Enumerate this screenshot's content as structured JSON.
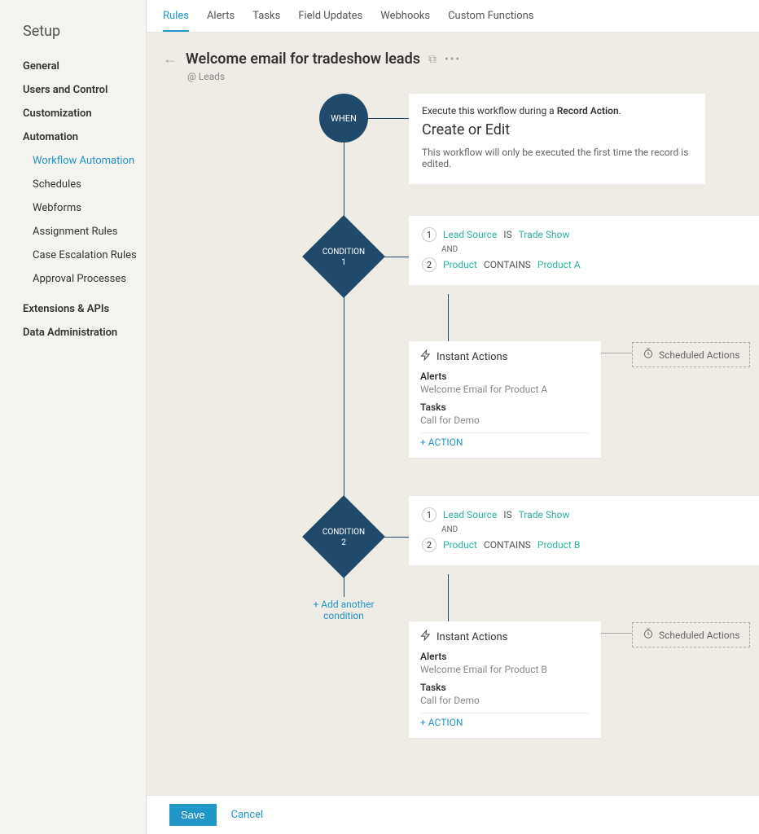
{
  "sidebar": {
    "title": "Setup",
    "groups": [
      {
        "label": "General"
      },
      {
        "label": "Users and Control"
      },
      {
        "label": "Customization"
      },
      {
        "label": "Automation",
        "subs": [
          "Workflow Automation",
          "Schedules",
          "Webforms",
          "Assignment Rules",
          "Case Escalation Rules",
          "Approval Processes"
        ]
      },
      {
        "label": "Extensions & APIs"
      },
      {
        "label": "Data Administration"
      }
    ]
  },
  "tabs": [
    "Rules",
    "Alerts",
    "Tasks",
    "Field Updates",
    "Webhooks",
    "Custom Functions"
  ],
  "header": {
    "title": "Welcome email for tradeshow leads",
    "context": "@ Leads"
  },
  "when": {
    "label": "WHEN",
    "line1a": "Execute this workflow during a ",
    "line1b": "Record Action",
    "line1c": ".",
    "mode": "Create or Edit",
    "desc": "This workflow will only be executed the first time the record is edited."
  },
  "cond1": {
    "label": "CONDITION",
    "num": "1",
    "row1_field": "Lead Source",
    "row1_op": "IS",
    "row1_val": "Trade Show",
    "and": "AND",
    "row2_field": "Product",
    "row2_op": "CONTAINS",
    "row2_val": "Product A"
  },
  "cond2": {
    "label": "CONDITION",
    "num": "2",
    "row1_field": "Lead Source",
    "row1_op": "IS",
    "row1_val": "Trade Show",
    "and": "AND",
    "row2_field": "Product",
    "row2_op": "CONTAINS",
    "row2_val": "Product B"
  },
  "actions1": {
    "title": "Instant Actions",
    "alerts_h": "Alerts",
    "alerts_v": "Welcome Email for Product A",
    "tasks_h": "Tasks",
    "tasks_v": "Call for Demo",
    "add": "+ ACTION",
    "sched": "Scheduled Actions"
  },
  "actions2": {
    "title": "Instant Actions",
    "alerts_h": "Alerts",
    "alerts_v": "Welcome Email for Product B",
    "tasks_h": "Tasks",
    "tasks_v": "Call for Demo",
    "add": "+ ACTION",
    "sched": "Scheduled Actions"
  },
  "addCond": "+ Add another condition",
  "footer": {
    "save": "Save",
    "cancel": "Cancel"
  }
}
